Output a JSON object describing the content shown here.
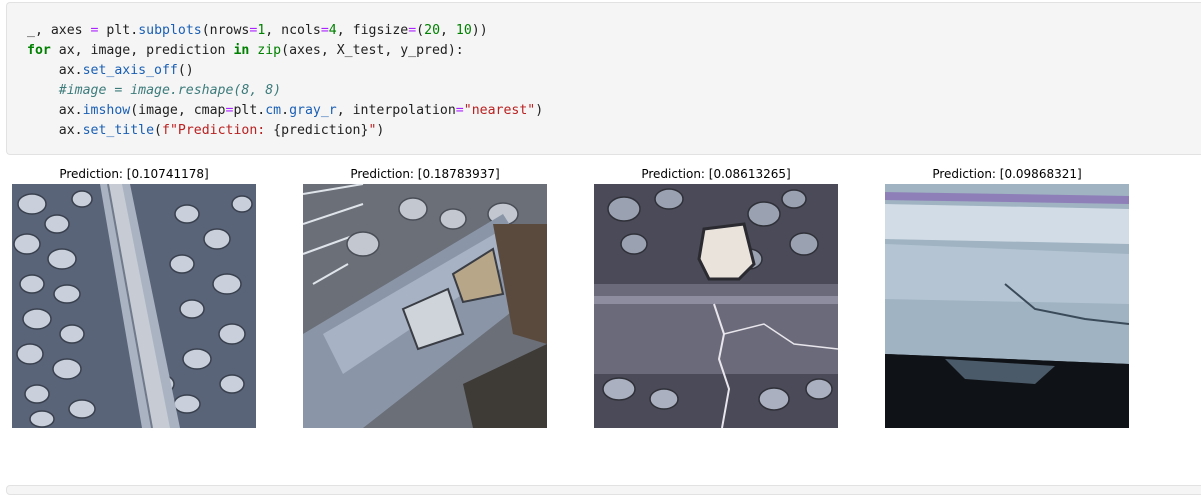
{
  "code_cell": {
    "lines": [
      [
        {
          "t": "_, axes ",
          "c": ""
        },
        {
          "t": "=",
          "c": "op"
        },
        {
          "t": " plt.",
          "c": ""
        },
        {
          "t": "subplots",
          "c": "attr"
        },
        {
          "t": "(nrows",
          "c": ""
        },
        {
          "t": "=",
          "c": "op"
        },
        {
          "t": "1",
          "c": "num"
        },
        {
          "t": ", ncols",
          "c": ""
        },
        {
          "t": "=",
          "c": "op"
        },
        {
          "t": "4",
          "c": "num"
        },
        {
          "t": ", figsize",
          "c": ""
        },
        {
          "t": "=",
          "c": "op"
        },
        {
          "t": "(",
          "c": ""
        },
        {
          "t": "20",
          "c": "num"
        },
        {
          "t": ", ",
          "c": ""
        },
        {
          "t": "10",
          "c": "num"
        },
        {
          "t": "))",
          "c": ""
        }
      ],
      [
        {
          "t": "for",
          "c": "kw"
        },
        {
          "t": " ax, image, prediction ",
          "c": ""
        },
        {
          "t": "in",
          "c": "kw"
        },
        {
          "t": " ",
          "c": ""
        },
        {
          "t": "zip",
          "c": "bi"
        },
        {
          "t": "(axes, X_test, y_pred):",
          "c": ""
        }
      ],
      [
        {
          "t": "    ax.",
          "c": ""
        },
        {
          "t": "set_axis_off",
          "c": "attr"
        },
        {
          "t": "()",
          "c": ""
        }
      ],
      [
        {
          "t": "    ",
          "c": ""
        },
        {
          "t": "#image = image.reshape(8, 8)",
          "c": "com"
        }
      ],
      [
        {
          "t": "    ax.",
          "c": ""
        },
        {
          "t": "imshow",
          "c": "attr"
        },
        {
          "t": "(image, cmap",
          "c": ""
        },
        {
          "t": "=",
          "c": "op"
        },
        {
          "t": "plt.",
          "c": ""
        },
        {
          "t": "cm",
          "c": "attr"
        },
        {
          "t": ".",
          "c": ""
        },
        {
          "t": "gray_r",
          "c": "attr"
        },
        {
          "t": ", interpolation",
          "c": ""
        },
        {
          "t": "=",
          "c": "op"
        },
        {
          "t": "\"nearest\"",
          "c": "str"
        },
        {
          "t": ")",
          "c": ""
        }
      ],
      [
        {
          "t": "    ax.",
          "c": ""
        },
        {
          "t": "set_title",
          "c": "attr"
        },
        {
          "t": "(",
          "c": ""
        },
        {
          "t": "f\"Prediction: ",
          "c": "str"
        },
        {
          "t": "{prediction}",
          "c": ""
        },
        {
          "t": "\"",
          "c": "str"
        },
        {
          "t": ")",
          "c": ""
        }
      ]
    ]
  },
  "output": {
    "panels": [
      {
        "title": "Prediction: [0.10741178]"
      },
      {
        "title": "Prediction: [0.18783937]"
      },
      {
        "title": "Prediction: [0.08613265]"
      },
      {
        "title": "Prediction: [0.09868321]"
      }
    ]
  },
  "colors": {
    "cell_background": "#f5f5f5",
    "keyword": "#008000",
    "operator": "#aa22ff",
    "string": "#ba2121",
    "comment": "#3d7b7b",
    "attribute": "#1a5fb4"
  }
}
